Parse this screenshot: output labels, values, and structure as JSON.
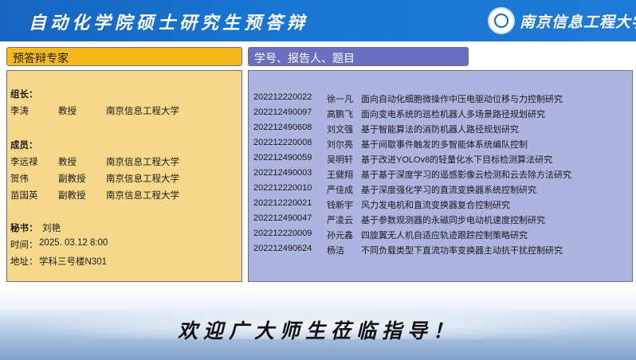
{
  "header": {
    "title": "自动化学院硕士研究生预答辩",
    "university_name": "南京信息工程大学"
  },
  "committee": {
    "heading": "预答辩专家",
    "chair_label": "组长：",
    "chair": {
      "name": "李涛",
      "title": "教授",
      "org": "南京信息工程大学"
    },
    "members_label": "成员：",
    "members": [
      {
        "name": "李远禄",
        "title": "教授",
        "org": "南京信息工程大学"
      },
      {
        "name": "贺伟",
        "title": "副教授",
        "org": "南京信息工程大学"
      },
      {
        "name": "苗国英",
        "title": "副教授",
        "org": "南京信息工程大学"
      }
    ],
    "secretary_label": "秘书：",
    "secretary_name": "刘艳",
    "time_label": "时间：",
    "time_value": "2025. 03.12  8:00",
    "location_label": "地址：",
    "location_value": "学科三号楼N301"
  },
  "students": {
    "heading": "学号、报告人、题目",
    "rows": [
      {
        "id": "202212220022",
        "name": "徐一凡",
        "topic": "面向自动化细胞微操作中压电驱动位移与力控制研究"
      },
      {
        "id": "202212490097",
        "name": "高鹏飞",
        "topic": "面向变电系统的巡检机器人多场景路径规划研究"
      },
      {
        "id": "202212490608",
        "name": "刘文强",
        "topic": "基于智能算法的消防机器人路径规划研究"
      },
      {
        "id": "202212220008",
        "name": "刘尔亮",
        "topic": "基于间歇事件触发的多智能体系统编队控制"
      },
      {
        "id": "202212490059",
        "name": "吴明轩",
        "topic": "基于改进YOLOv8的轻量化水下目标检测算法研究"
      },
      {
        "id": "202212490003",
        "name": "王健翔",
        "topic": "基于基于深度学习的遥感影像云检测和云去除方法研究"
      },
      {
        "id": "202212220010",
        "name": "严佳成",
        "topic": "基于深度强化学习的直流变换器系统控制研究"
      },
      {
        "id": "202212220021",
        "name": "钱新宇",
        "topic": "风力发电机和直流变换器复合控制研究"
      },
      {
        "id": "202212490047",
        "name": "严凌云",
        "topic": "基于参数观测器的永磁同步电动机速度控制研究"
      },
      {
        "id": "202212220009",
        "name": "孙元鑫",
        "topic": "四旋翼无人机自适应轨迹跟踪控制策略研究"
      },
      {
        "id": "202212490624",
        "name": "杨洁",
        "topic": "不同负载类型下直流功率变换器主动抗干扰控制研究"
      }
    ]
  },
  "footer": {
    "text": "欢迎广大师生莅临指导！"
  },
  "colors": {
    "header_bg": "#1976d2",
    "committee_head": "#f5b91c",
    "committee_body": "#f8d88a",
    "students_head": "#6b6fc0",
    "students_body": "#aeb4e0"
  },
  "icons": {
    "logo": "university-seal-icon"
  }
}
